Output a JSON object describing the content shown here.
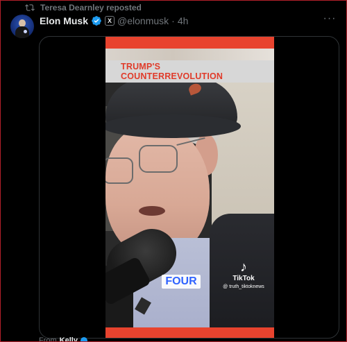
{
  "repost": {
    "label": "Teresa Dearnley reposted",
    "icon": "repost-icon"
  },
  "tweet": {
    "author_name": "Elon Musk",
    "verified": true,
    "handle": "@elonmusk",
    "separator": "·",
    "time": "4h",
    "x_badge": "X",
    "more_icon": "more-icon"
  },
  "video": {
    "title": "TRUMP'S COUNTERREVOLUTION",
    "caption": "FOUR",
    "tiktok_brand": "TikTok",
    "tiktok_user": "@ truth_tiktoknews",
    "accent_color": "#e8432e",
    "caption_color": "#2f63ff"
  },
  "footer": {
    "from_label": "From",
    "from_name": "Kelly"
  },
  "colors": {
    "background": "#000000",
    "text": "#e7e9ea",
    "muted": "#71767b",
    "verified": "#1d9bf0"
  }
}
